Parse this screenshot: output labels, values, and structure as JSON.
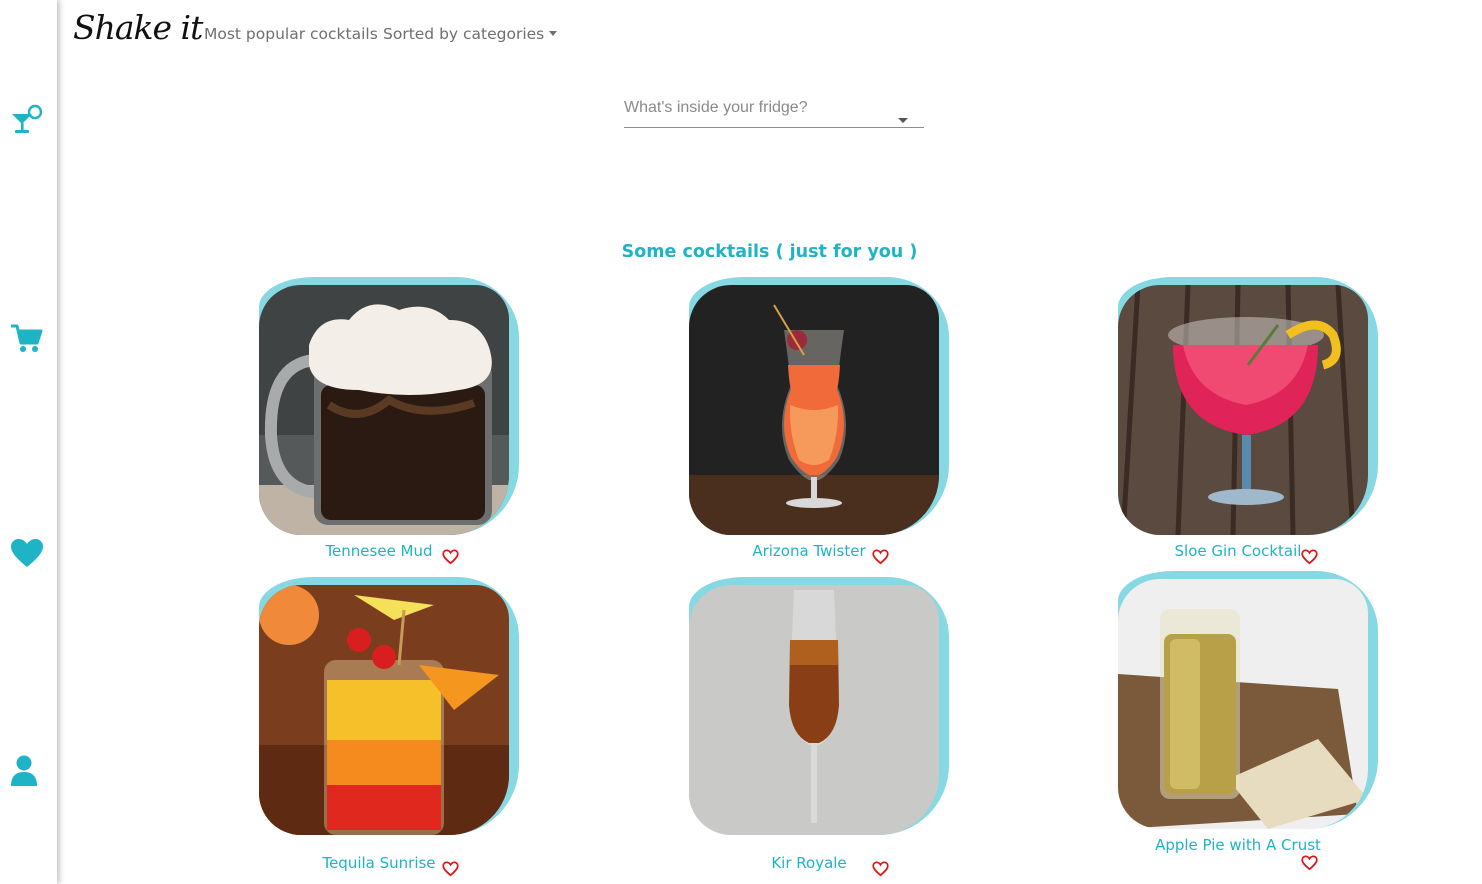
{
  "navbar": {
    "brand": "Shake it",
    "links": [
      "Most popular cocktails",
      "Sorted by categories"
    ]
  },
  "sidebar": {
    "items": [
      "cocktail-icon",
      "cart-icon",
      "heart-icon",
      "user-icon"
    ]
  },
  "search": {
    "placeholder": "What's inside your fridge?"
  },
  "main": {
    "section_title": "Some cocktails ( just for you )",
    "cocktails": [
      {
        "name": "Tennesee Mud",
        "image": "coffee-mug-photo"
      },
      {
        "name": "Arizona Twister",
        "image": "hurricane-glass-photo"
      },
      {
        "name": "Sloe Gin Cocktail",
        "image": "red-goblet-photo"
      },
      {
        "name": "Tequila Sunrise",
        "image": "sunrise-glass-photo"
      },
      {
        "name": "Kir Royale",
        "image": "champagne-flute-photo"
      },
      {
        "name": "Apple Pie with A Crust",
        "image": "highball-glass-photo"
      }
    ]
  },
  "colors": {
    "accent": "#1fb3c6",
    "frame": "#86d8e2",
    "heart": "#e01414"
  }
}
